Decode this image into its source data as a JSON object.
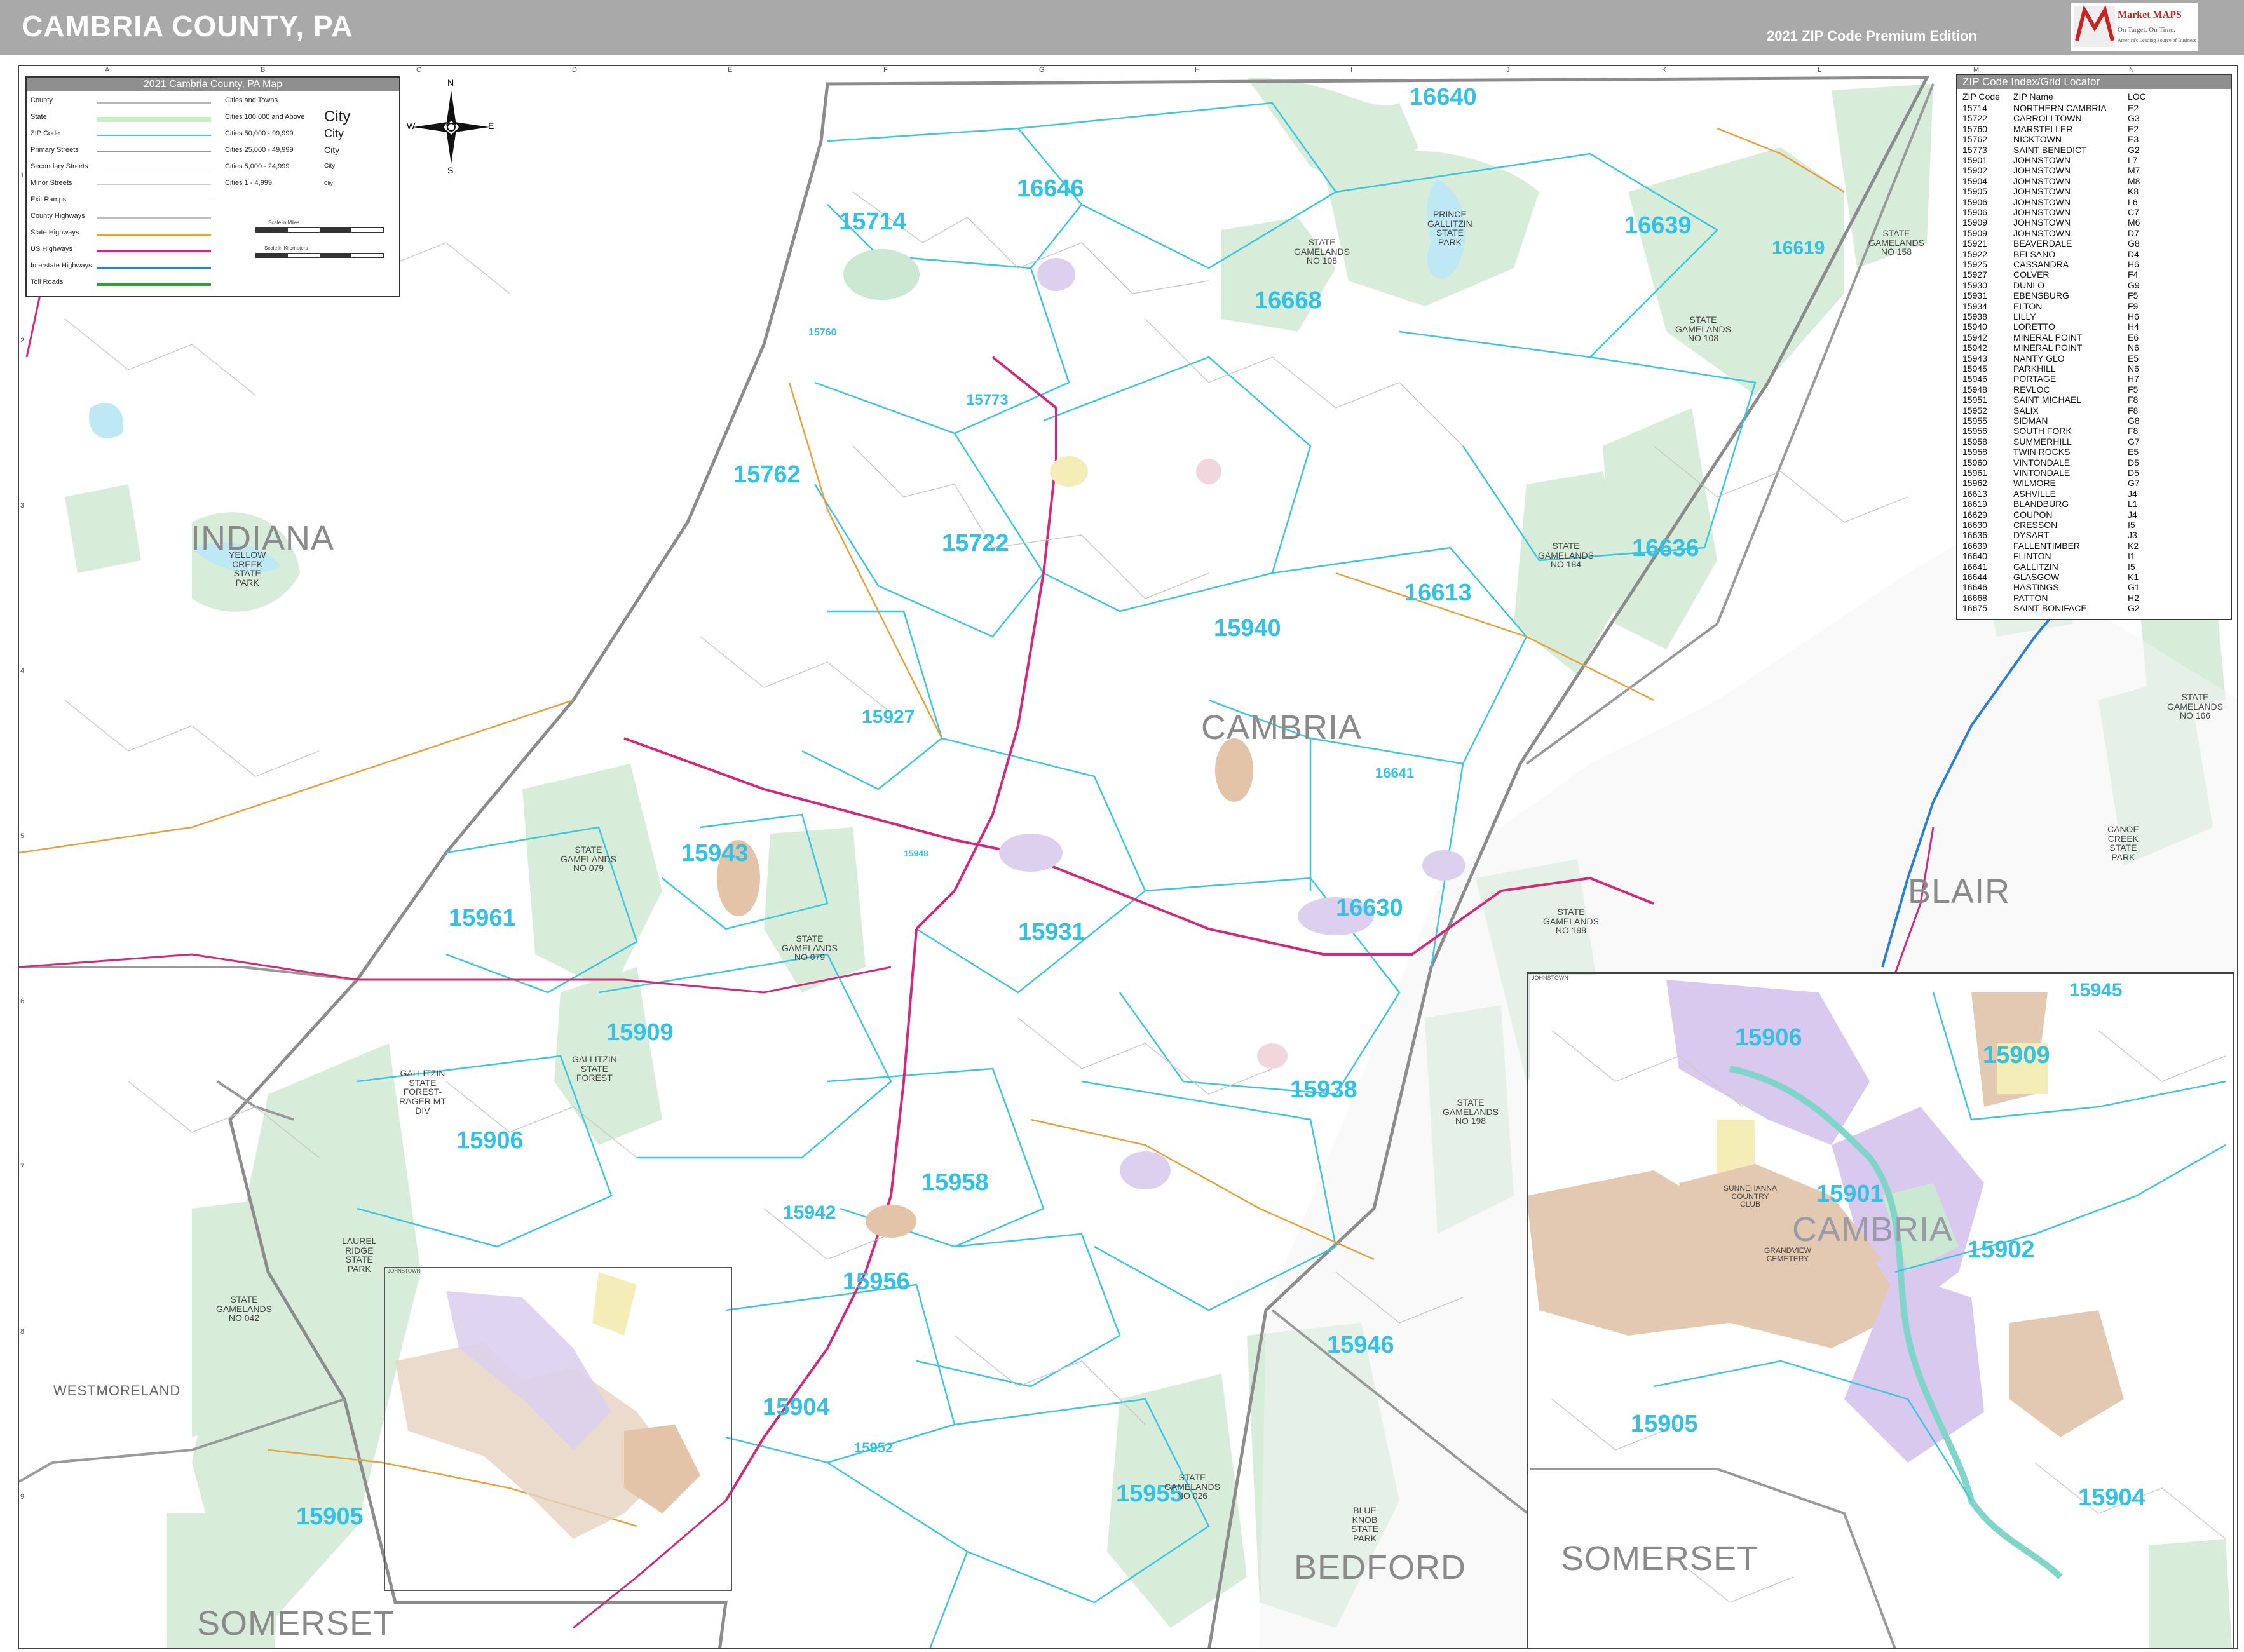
{
  "header": {
    "title": "CAMBRIA COUNTY, PA",
    "edition": "2021 ZIP Code Premium Edition",
    "logo_text": "Market MAPS",
    "logo_tagline": "On Target. On Time.",
    "logo_subtitle": "America's Leading Source of Business Maps"
  },
  "colors": {
    "header_bg": "#a9a9a9",
    "zip_label": "#33c2e6",
    "zip_boundary": "#3cc6e0",
    "state_gamelands": "#d7ecd9",
    "water": "#bfe8f5",
    "us_highway": "#d6287a",
    "state_highway": "#e6a23c",
    "county_boundary": "#8c8c8c",
    "inset_city_purple": "#d9c9ef",
    "inset_city_tan": "#e3c4a8"
  },
  "legend": {
    "title": "2021 Cambria County, PA Map",
    "rows": [
      "County",
      "State",
      "ZIP Code",
      "Primary Streets",
      "Secondary Streets",
      "Minor Streets",
      "Exit Ramps",
      "County Highways",
      "State Highways",
      "US Highways",
      "Interstate Highways",
      "Toll Roads"
    ],
    "cities_header": "Cities and Towns",
    "cities": [
      {
        "label": "Cities 100,000 and Above",
        "sample": "City"
      },
      {
        "label": "Cities 50,000 - 99,999",
        "sample": "City"
      },
      {
        "label": "Cities 25,000 - 49,999",
        "sample": "City"
      },
      {
        "label": "Cities 5,000 - 24,999",
        "sample": "City"
      },
      {
        "label": "Cities 1 - 4,999",
        "sample": "City"
      }
    ],
    "scale_miles": "Scale in Miles",
    "scale_km": "Scale in Kilometers"
  },
  "compass": {
    "n": "N",
    "s": "S",
    "e": "E",
    "w": "W"
  },
  "grid": {
    "letters": [
      "A",
      "B",
      "C",
      "D",
      "E",
      "F",
      "G",
      "H",
      "I",
      "J",
      "K",
      "L",
      "M",
      "N"
    ],
    "numbers": [
      "1",
      "2",
      "3",
      "4",
      "5",
      "6",
      "7",
      "8",
      "9"
    ]
  },
  "zip_index": {
    "title": "ZIP Code Index/Grid Locator",
    "columns": [
      "ZIP Code",
      "ZIP Name",
      "LOC"
    ],
    "rows": [
      [
        "15714",
        "NORTHERN CAMBRIA",
        "E2"
      ],
      [
        "15722",
        "CARROLLTOWN",
        "G3"
      ],
      [
        "15760",
        "MARSTELLER",
        "E2"
      ],
      [
        "15762",
        "NICKTOWN",
        "E3"
      ],
      [
        "15773",
        "SAINT BENEDICT",
        "G2"
      ],
      [
        "15901",
        "JOHNSTOWN",
        "L7"
      ],
      [
        "15902",
        "JOHNSTOWN",
        "M7"
      ],
      [
        "15904",
        "JOHNSTOWN",
        "M8"
      ],
      [
        "15905",
        "JOHNSTOWN",
        "K8"
      ],
      [
        "15906",
        "JOHNSTOWN",
        "L6"
      ],
      [
        "15906",
        "JOHNSTOWN",
        "C7"
      ],
      [
        "15909",
        "JOHNSTOWN",
        "M6"
      ],
      [
        "15909",
        "JOHNSTOWN",
        "D7"
      ],
      [
        "15921",
        "BEAVERDALE",
        "G8"
      ],
      [
        "15922",
        "BELSANO",
        "D4"
      ],
      [
        "15925",
        "CASSANDRA",
        "H6"
      ],
      [
        "15927",
        "COLVER",
        "F4"
      ],
      [
        "15930",
        "DUNLO",
        "G9"
      ],
      [
        "15931",
        "EBENSBURG",
        "F5"
      ],
      [
        "15934",
        "ELTON",
        "F9"
      ],
      [
        "15938",
        "LILLY",
        "H6"
      ],
      [
        "15940",
        "LORETTO",
        "H4"
      ],
      [
        "15942",
        "MINERAL POINT",
        "E6"
      ],
      [
        "15942",
        "MINERAL POINT",
        "N6"
      ],
      [
        "15943",
        "NANTY GLO",
        "E5"
      ],
      [
        "15945",
        "PARKHILL",
        "N6"
      ],
      [
        "15946",
        "PORTAGE",
        "H7"
      ],
      [
        "15948",
        "REVLOC",
        "F5"
      ],
      [
        "15951",
        "SAINT MICHAEL",
        "F8"
      ],
      [
        "15952",
        "SALIX",
        "F8"
      ],
      [
        "15955",
        "SIDMAN",
        "G8"
      ],
      [
        "15956",
        "SOUTH FORK",
        "F8"
      ],
      [
        "15958",
        "SUMMERHILL",
        "G7"
      ],
      [
        "15958",
        "TWIN ROCKS",
        "E5"
      ],
      [
        "15960",
        "VINTONDALE",
        "D5"
      ],
      [
        "15961",
        "VINTONDALE",
        "D5"
      ],
      [
        "15962",
        "WILMORE",
        "G7"
      ],
      [
        "16613",
        "ASHVILLE",
        "J4"
      ],
      [
        "16619",
        "BLANDBURG",
        "L1"
      ],
      [
        "16629",
        "COUPON",
        "J4"
      ],
      [
        "16630",
        "CRESSON",
        "I5"
      ],
      [
        "16636",
        "DYSART",
        "J3"
      ],
      [
        "16639",
        "FALLENTIMBER",
        "K2"
      ],
      [
        "16640",
        "FLINTON",
        "I1"
      ],
      [
        "16641",
        "GALLITZIN",
        "I5"
      ],
      [
        "16644",
        "GLASGOW",
        "K1"
      ],
      [
        "16646",
        "HASTINGS",
        "G1"
      ],
      [
        "16668",
        "PATTON",
        "H2"
      ],
      [
        "16675",
        "SAINT BONIFACE",
        "G2"
      ]
    ]
  },
  "county_labels": [
    {
      "id": "indiana",
      "text": "INDIANA"
    },
    {
      "id": "cambria",
      "text": "CAMBRIA"
    },
    {
      "id": "blair",
      "text": "BLAIR"
    },
    {
      "id": "westmoreland",
      "text": "WESTMORELAND"
    },
    {
      "id": "somerset",
      "text": "SOMERSET"
    },
    {
      "id": "bedford",
      "text": "BEDFORD"
    },
    {
      "id": "somerset-inset",
      "text": "SOMERSET"
    },
    {
      "id": "cambria-inset",
      "text": "CAMBRIA"
    }
  ],
  "zip_labels": [
    {
      "id": "z16640",
      "text": "16640"
    },
    {
      "id": "z16646",
      "text": "16646"
    },
    {
      "id": "z15714",
      "text": "15714"
    },
    {
      "id": "z16639",
      "text": "16639"
    },
    {
      "id": "z16619",
      "text": "16619"
    },
    {
      "id": "z16668",
      "text": "16668"
    },
    {
      "id": "z15773",
      "text": "15773"
    },
    {
      "id": "z15760",
      "text": "15760"
    },
    {
      "id": "z15762",
      "text": "15762"
    },
    {
      "id": "z15722",
      "text": "15722"
    },
    {
      "id": "z16636",
      "text": "16636"
    },
    {
      "id": "z16613",
      "text": "16613"
    },
    {
      "id": "z15940",
      "text": "15940"
    },
    {
      "id": "z15927",
      "text": "15927"
    },
    {
      "id": "z16641",
      "text": "16641"
    },
    {
      "id": "z15943",
      "text": "15943"
    },
    {
      "id": "z15948",
      "text": "15948"
    },
    {
      "id": "z15961",
      "text": "15961"
    },
    {
      "id": "z16630",
      "text": "16630"
    },
    {
      "id": "z15931",
      "text": "15931"
    },
    {
      "id": "z15909",
      "text": "15909"
    },
    {
      "id": "z15938",
      "text": "15938"
    },
    {
      "id": "z15906",
      "text": "15906"
    },
    {
      "id": "z15958",
      "text": "15958"
    },
    {
      "id": "z15942",
      "text": "15942"
    },
    {
      "id": "z15956",
      "text": "15956"
    },
    {
      "id": "z15946",
      "text": "15946"
    },
    {
      "id": "z15904",
      "text": "15904"
    },
    {
      "id": "z15952",
      "text": "15952"
    },
    {
      "id": "z15955",
      "text": "15955"
    },
    {
      "id": "z15905",
      "text": "15905"
    },
    {
      "id": "zi15945",
      "text": "15945"
    },
    {
      "id": "zi15906",
      "text": "15906"
    },
    {
      "id": "zi15909",
      "text": "15909"
    },
    {
      "id": "zi15901",
      "text": "15901"
    },
    {
      "id": "zi15902",
      "text": "15902"
    },
    {
      "id": "zi15905",
      "text": "15905"
    },
    {
      "id": "zi15904",
      "text": "15904"
    }
  ],
  "land_labels": [
    {
      "id": "yellow-creek",
      "text": "YELLOW\nCREEK\nSTATE\nPARK"
    },
    {
      "id": "prince-gallitzin",
      "text": "PRINCE\nGALLITZIN\nSTATE\nPARK"
    },
    {
      "id": "sg108a",
      "text": "STATE\nGAMELANDS\nNO 108"
    },
    {
      "id": "sg108b",
      "text": "STATE\nGAMELANDS\nNO 108"
    },
    {
      "id": "sg158",
      "text": "STATE\nGAMELANDS\nNO 158"
    },
    {
      "id": "sg184",
      "text": "STATE\nGAMELANDS\nNO 184"
    },
    {
      "id": "sg079a",
      "text": "STATE\nGAMELANDS\nNO 079"
    },
    {
      "id": "sg079b",
      "text": "STATE\nGAMELANDS\nNO 079"
    },
    {
      "id": "sg198a",
      "text": "STATE\nGAMELANDS\nNO 198"
    },
    {
      "id": "sg198b",
      "text": "STATE\nGAMELANDS\nNO 198"
    },
    {
      "id": "sg042",
      "text": "STATE\nGAMELANDS\nNO 042"
    },
    {
      "id": "sg026",
      "text": "STATE\nGAMELANDS\nNO 026"
    },
    {
      "id": "sg166",
      "text": "STATE\nGAMELANDS\nNO 166"
    },
    {
      "id": "gallitzin-forest",
      "text": "GALLITZIN\nSTATE\nFOREST"
    },
    {
      "id": "gallitzin-div",
      "text": "GALLITZIN\nSTATE\nFOREST-\nRAGER MT\nDIV"
    },
    {
      "id": "laurel-ridge",
      "text": "LAUREL\nRIDGE\nSTATE\nPARK"
    },
    {
      "id": "canoe-creek",
      "text": "CANOE\nCREEK\nSTATE\nPARK"
    },
    {
      "id": "blue-knob",
      "text": "BLUE\nKNOB\nSTATE\nPARK"
    },
    {
      "id": "sunnehanna",
      "text": "SUNNEHANNA\nCOUNTRY\nCLUB"
    },
    {
      "id": "grandview",
      "text": "GRANDVIEW\nCEMETERY"
    }
  ],
  "inset": {
    "label": "JOHNSTOWN",
    "mini_label": "JOHNSTOWN"
  }
}
